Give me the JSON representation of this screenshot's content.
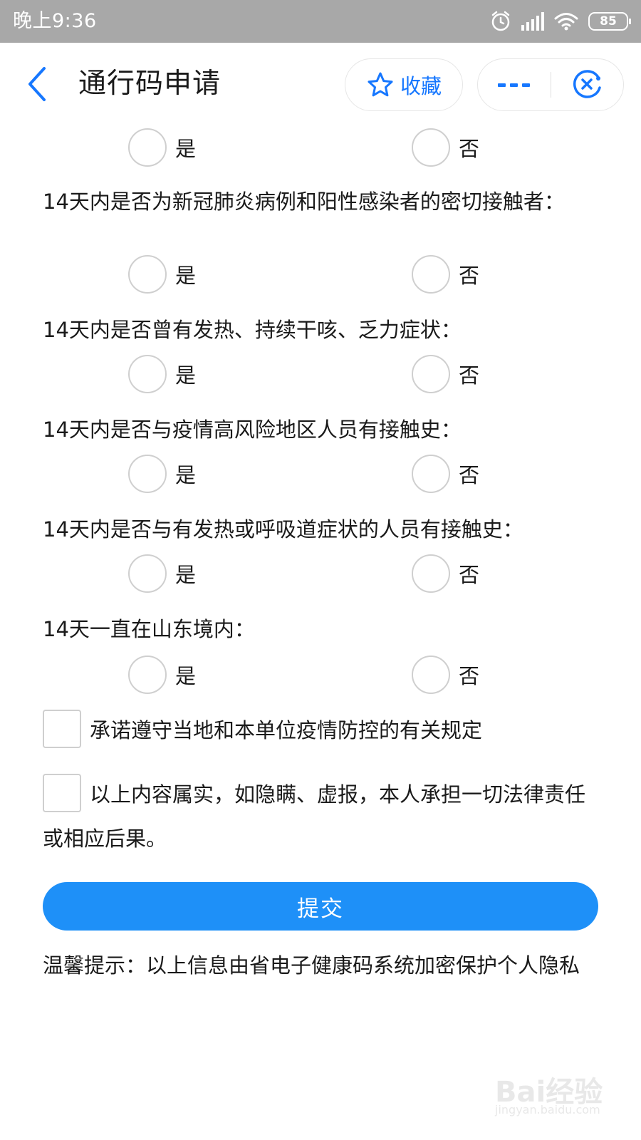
{
  "status_bar": {
    "time": "晚上9:36",
    "battery": "85",
    "icons": [
      "alarm-icon",
      "signal-icon",
      "wifi-icon",
      "battery-icon"
    ]
  },
  "nav": {
    "title": "通行码申请",
    "favorite_label": "收藏",
    "accent_color": "#1677ff"
  },
  "form": {
    "first_row_options": {
      "yes": "是",
      "no": "否"
    },
    "questions": [
      {
        "text": "14天内是否为新冠肺炎病例和阳性感染者的密切接触者：",
        "yes": "是",
        "no": "否"
      },
      {
        "text": "14天内是否曾有发热、持续干咳、乏力症状：",
        "yes": "是",
        "no": "否"
      },
      {
        "text": "14天内是否与疫情高风险地区人员有接触史：",
        "yes": "是",
        "no": "否"
      },
      {
        "text": "14天内是否与有发热或呼吸道症状的人员有接触史：",
        "yes": "是",
        "no": "否"
      },
      {
        "text": "14天一直在山东境内：",
        "yes": "是",
        "no": "否"
      }
    ],
    "checkboxes": [
      {
        "text": "承诺遵守当地和本单位疫情防控的有关规定"
      },
      {
        "text": "以上内容属实，如隐瞒、虚报，本人承担一切法律责任或相应后果。"
      }
    ],
    "submit_label": "提交",
    "submit_color": "#1e90f8"
  },
  "tip": "温馨提示：以上信息由省电子健康码系统加密保护个人隐私",
  "watermark": {
    "mark": "Bai经验",
    "sub": "jingyan.baidu.com"
  }
}
